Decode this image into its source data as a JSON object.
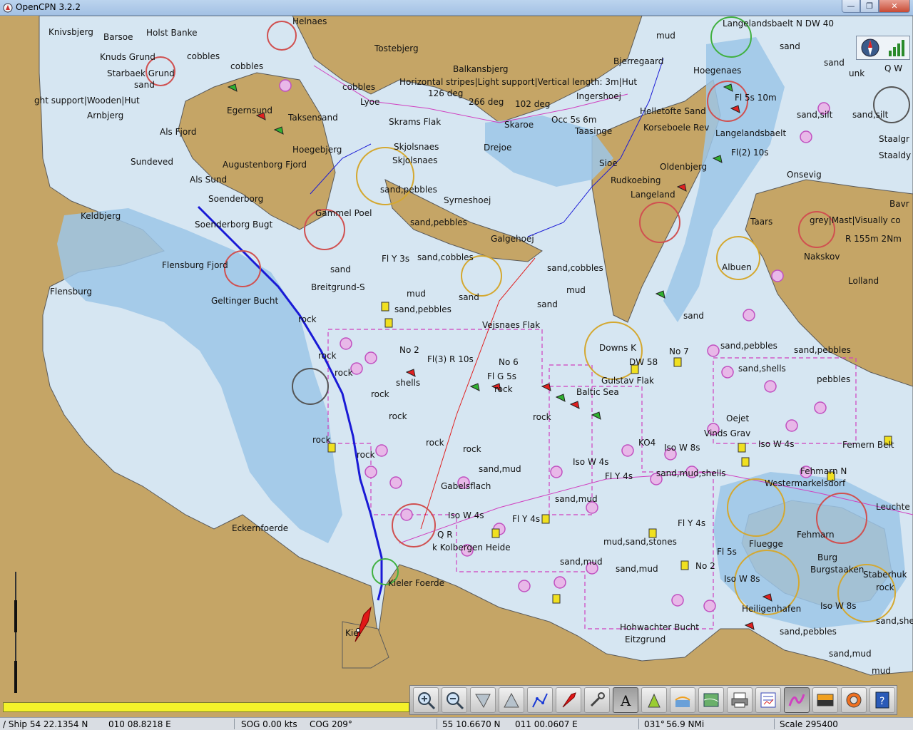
{
  "window": {
    "title": "OpenCPN 3.2.2",
    "minimize_label": "—",
    "maximize_label": "❐",
    "close_label": "✕"
  },
  "colors": {
    "land": "#c5a566",
    "shallow_water": "#9cc6e8",
    "deep_water": "#d6e6f2",
    "route_line": "#1a1ad6",
    "magenta": "#d040c0",
    "progress_fill": "#f4f22a"
  },
  "chart_labels": {
    "knivsbjerg": "Knivsbjerg",
    "barsoe": "Barsoe",
    "holst_banke": "Holst Banke",
    "helnaes": "Helnaes",
    "knuds_grund": "Knuds Grund",
    "cobbles_1": "cobbles",
    "cobbles_2": "cobbles",
    "cobbles_3": "cobbles",
    "starbaek_grund": "Starbaek Grund",
    "sand_1": "sand",
    "tostebjerg": "Tostebjerg",
    "balkansbjerg": "Balkansbjerg",
    "light_support_1": "ght support|Wooden|Hut",
    "horizontal_stripes": "Horizontal stripes|Light support|Vertical length: 3m|Hut",
    "deg_126": "126 deg",
    "deg_266": "266 deg",
    "deg_102": "102 deg",
    "ingershoej": "Ingershoej",
    "bjerregaard": "Bjerregaard",
    "helletofte_sand": "Helletofte Sand",
    "arnbjerg": "Arnbjerg",
    "egernsund": "Egernsund",
    "taksensand": "Taksensand",
    "lyoe": "Lyoe",
    "skrams_flak": "Skrams Flak",
    "skaroe": "Skaroe",
    "occ_5s": "Occ 5s 6m",
    "taasinge": "Taasinge",
    "korseboele_rev": "Korseboele Rev",
    "als_fjord": "Als Fjord",
    "sundeved": "Sundeved",
    "augustenborg_fjord": "Augustenborg Fjord",
    "hoegebjerg": "Hoegebjerg",
    "skjolsnaes_1": "Skjolsnaes",
    "skjolsnaes_2": "Skjolsnaes",
    "drejoe": "Drejoe",
    "sioe": "Sioe",
    "rudkoebing": "Rudkoebing",
    "langeland_1": "Langeland",
    "als_sund": "Als Sund",
    "soenderborg": "Soenderborg",
    "sand_pebbles_1": "sand,pebbles",
    "syrneshoej": "Syrneshoej",
    "keldbjerg": "Keldbjerg",
    "gammel_poel": "Gammel Poel",
    "sand_pebbles_2": "sand,pebbles",
    "galgehoej": "Galgehoej",
    "soenderborg_bugt": "Soenderborg Bugt",
    "flensburg_fjord": "Flensburg Fjord",
    "fl_y_3s": "Fl Y 3s",
    "sand_cobbles_1": "sand,cobbles",
    "sand_cobbles_2": "sand,cobbles",
    "flensburg": "Flensburg",
    "breitgrund": "Breitgrund-S",
    "mud_1": "mud",
    "mud_2": "mud",
    "geltinger_bucht": "Geltinger Bucht",
    "sand_pebbles_3": "sand,pebbles",
    "vejsnaes_flak": "Vejsnaes Flak",
    "rock_1": "rock",
    "downs_k": "Downs K",
    "no_2_a": "No 2",
    "fl3_r_10s": "Fl(3) R 10s",
    "no_6": "No 6",
    "shells": "shells",
    "fl_g_5s": "Fl G 5s",
    "gulstav_flak": "Gulstav Flak",
    "baltic_sea": "Baltic Sea",
    "dw_58": "DW 58",
    "no_7": "No 7",
    "sand_pebbles_4": "sand,pebbles",
    "sand_pebbles_5": "sand,pebbles",
    "sand_shells": "sand,shells",
    "pebbles": "pebbles",
    "oejet": "Oejet",
    "vinds_grav": "Vinds Grav",
    "iso_w_4s_1": "Iso W 4s",
    "iso_w_8s": "Iso W 8s",
    "iso_w_4s_2": "Iso W 4s",
    "iso_w_4s_3": "Iso W 4s",
    "femern_belt": "Femern Belt",
    "fehmarn_n": "Fehmarn N",
    "westermarkelsdorf": "Westermarkelsdorf",
    "ko4": "KO4",
    "sand_mud_shells": "sand,mud,shells",
    "gabelsflach": "Gabelsflach",
    "fl_y_4s_1": "Fl Y 4s",
    "fl_y_4s_2": "Fl Y 4s",
    "fl_y_4s_3": "Fl Y 4s",
    "sand_mud_1": "sand,mud",
    "sand_mud_2": "sand,mud",
    "sand_mud_3": "sand,mud",
    "mud_sand_stones": "mud,sand,stones",
    "sand_mud_4": "sand,mud",
    "q_r": "Q R",
    "kolbergen_heide": "k Kolbergen Heide",
    "eckernfoerde": "Eckernfoerde",
    "kieler_foerde": "Kieler Foerde",
    "kiel": "Kiel",
    "hohwachter_bucht": "Hohwachter Bucht",
    "eitzgrund": "Eitzgrund",
    "fehmarn": "Fehmarn",
    "flugge": "Fluegge",
    "burg": "Burg",
    "burgstaaken": "Burgstaaken",
    "staberhuk": "Staberhuk",
    "no_2_b": "No 2",
    "iso_8s": "Iso W 8s",
    "sand_pebbles_6": "sand,pebbles",
    "sand_mud_5": "sand,mud",
    "mud_3": "mud",
    "langelandsbaelt_1": "Langelandsbaelt N DW 40",
    "langelandsbaelt_2": "Langelandsbaelt",
    "fl_5s_10m": "Fl 5s 10m",
    "hoegenaes": "Hoegenaes",
    "sand_silt_1": "sand,silt",
    "sand_silt_2": "sand,silt",
    "oldenbjerg": "Oldenbjerg",
    "onsevig": "Onsevig",
    "taars": "Taars",
    "nakskov": "Nakskov",
    "lolland": "Lolland",
    "grey_mast": "grey|Mast|Visually co",
    "r_155m": "R 155m 2Nm",
    "albuen": "Albuen",
    "staalgr": "Staalgr",
    "staaldy": "Staaldy",
    "bavr": "Bavr",
    "q_w": "Q W",
    "unk": "unk",
    "cobbles_r": "cobbles",
    "fl2_10s": "Fl(2) 10s",
    "sand_r1": "sand",
    "sand_r2": "sand",
    "fl_5s": "Fl 5s",
    "iso_w_8s_b": "Iso W 8s",
    "leuchte": "Leuchte",
    "heiligenhafen": "Heiligenhafen",
    "rock_r": "rock",
    "sand_shells_r": "sand,shells",
    "mud_r": "mud",
    "sand_misc_1": "sand",
    "sand_misc_2": "sand",
    "sand_misc_3": "sand",
    "sand_misc_4": "sand",
    "rock_misc_1": "rock",
    "rock_misc_2": "rock",
    "rock_misc_3": "rock",
    "rock_misc_4": "rock",
    "rock_misc_5": "rock",
    "rock_misc_6": "rock",
    "rock_misc_7": "rock",
    "rock_misc_8": "rock",
    "rock_misc_9": "rock",
    "rock_misc_10": "rock"
  },
  "toolbar": [
    {
      "name": "zoom-in-button",
      "icon": "zoom-in-icon"
    },
    {
      "name": "zoom-out-button",
      "icon": "zoom-out-icon"
    },
    {
      "name": "scale-in-button",
      "icon": "funnel-down-icon"
    },
    {
      "name": "scale-out-button",
      "icon": "funnel-up-icon"
    },
    {
      "name": "route-button",
      "icon": "route-icon"
    },
    {
      "name": "follow-button",
      "icon": "ship-icon"
    },
    {
      "name": "settings-button",
      "icon": "wrench-icon"
    },
    {
      "name": "text-button",
      "icon": "text-icon"
    },
    {
      "name": "current-button",
      "icon": "current-icon"
    },
    {
      "name": "tide-button",
      "icon": "tide-icon"
    },
    {
      "name": "chart-quilt-button",
      "icon": "chart-icon"
    },
    {
      "name": "print-button",
      "icon": "print-icon"
    },
    {
      "name": "route-manager-button",
      "icon": "route-manager-icon"
    },
    {
      "name": "track-button",
      "icon": "track-icon"
    },
    {
      "name": "color-scheme-button",
      "icon": "color-scheme-icon"
    },
    {
      "name": "mob-button",
      "icon": "lifebuoy-icon"
    },
    {
      "name": "help-button",
      "icon": "help-icon"
    }
  ],
  "status": {
    "ship": "/ Ship 54 22.1354 N",
    "ship_lon": "010 08.8218 E",
    "sog": "SOG 0.00 kts",
    "cog": "COG 209°",
    "cursor_lat": "55 10.6670 N",
    "cursor_lon": "011 00.0607 E",
    "bearing": "031°",
    "distance": "56.9 NMi",
    "scale": "Scale 295400"
  },
  "progress": {
    "value": 1.0
  }
}
